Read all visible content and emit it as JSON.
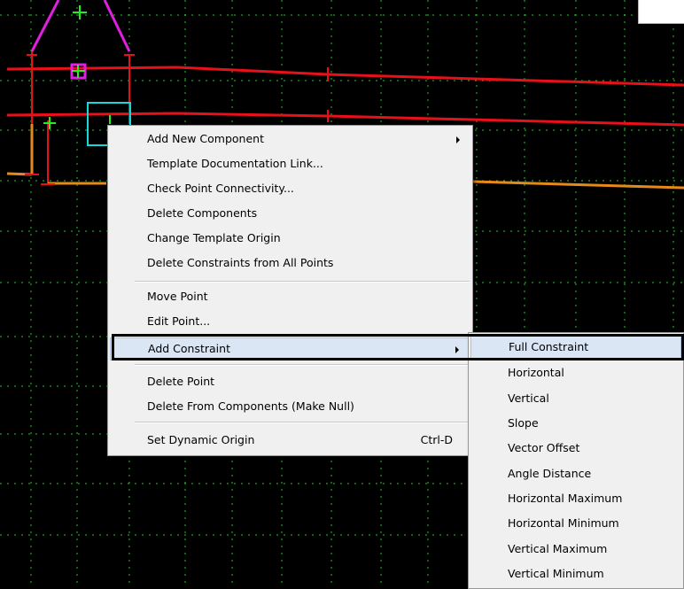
{
  "colors": {
    "background": "#000000",
    "grid": "#1fcc1f",
    "line_red": "#e8101a",
    "line_orange": "#e58a18",
    "line_magenta": "#e020e0",
    "point_cyan": "#19d7d7",
    "point_green": "#22ee22",
    "menu_bg": "#f0f0f0",
    "menu_highlight": "#dbe6f4"
  },
  "canvas": {
    "name": "template-drawing-view"
  },
  "context_menu": {
    "items": [
      {
        "label": "Add New Component",
        "has_submenu": true
      },
      {
        "label": "Template Documentation Link..."
      },
      {
        "label": "Check Point Connectivity..."
      },
      {
        "label": "Delete Components"
      },
      {
        "label": "Change Template Origin"
      },
      {
        "label": "Delete Constraints from All Points"
      },
      {
        "label": "Move Point"
      },
      {
        "label": "Edit Point..."
      },
      {
        "label": "Add Constraint",
        "has_submenu": true,
        "highlighted": true
      },
      {
        "label": "Delete Point"
      },
      {
        "label": "Delete From Components (Make Null)"
      },
      {
        "label": "Set Dynamic Origin",
        "shortcut": "Ctrl-D"
      }
    ]
  },
  "submenu": {
    "items": [
      {
        "label": "Full Constraint",
        "highlighted": true
      },
      {
        "label": "Horizontal"
      },
      {
        "label": "Vertical"
      },
      {
        "label": "Slope"
      },
      {
        "label": "Vector Offset"
      },
      {
        "label": "Angle Distance"
      },
      {
        "label": "Horizontal Maximum"
      },
      {
        "label": "Horizontal Minimum"
      },
      {
        "label": "Vertical Maximum"
      },
      {
        "label": "Vertical Minimum"
      }
    ]
  }
}
